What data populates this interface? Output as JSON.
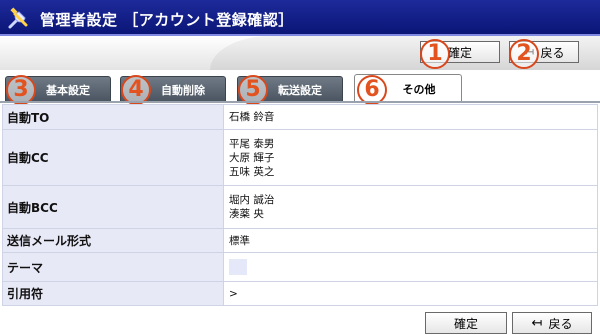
{
  "header": {
    "title": "管理者設定 ［アカウント登録確認］",
    "icon": "tools-icon"
  },
  "toolbar": {
    "confirm_label": "確定",
    "back_label": "戻る",
    "back_icon": "back-arrow-icon"
  },
  "markers": [
    "1",
    "2",
    "3",
    "4",
    "5",
    "6"
  ],
  "tabs": [
    {
      "label": "基本設定"
    },
    {
      "label": "自動削除"
    },
    {
      "label": "転送設定"
    },
    {
      "label": "その他",
      "active": true
    }
  ],
  "rows": {
    "auto_to": {
      "label": "自動TO",
      "values": [
        "石橋 鈴音"
      ]
    },
    "auto_cc": {
      "label": "自動CC",
      "values": [
        "平尾 泰男",
        "大原 輝子",
        "五味 英之"
      ]
    },
    "auto_bcc": {
      "label": "自動BCC",
      "values": [
        "堀内 誠治",
        "湊薬 央"
      ]
    },
    "mail_format": {
      "label": "送信メール形式",
      "value": "標準"
    },
    "theme": {
      "label": "テーマ",
      "swatch_color": "#e4e8f8"
    },
    "quote": {
      "label": "引用符",
      "value": ">"
    }
  },
  "footer": {
    "confirm_label": "確定",
    "back_label": "戻る"
  },
  "colors": {
    "header_bg": "#14208a",
    "marker": "#e2531f",
    "label_bg": "#e8e9f7",
    "tab_bg": "#5d6773"
  }
}
